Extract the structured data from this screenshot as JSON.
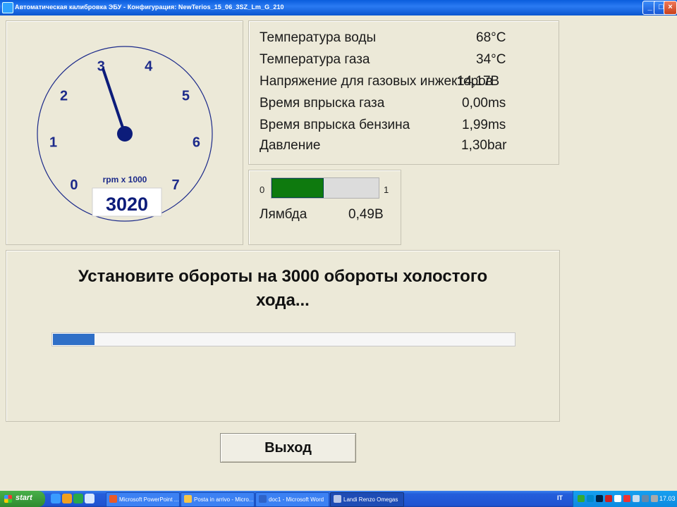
{
  "window": {
    "title": "Автоматическая калибровка ЭБУ - Конфигурация: NewTerios_15_06_3SZ_Lm_G_210",
    "minimize_label": "_",
    "maximize_label": "□",
    "close_label": "×"
  },
  "gauge": {
    "tick_labels": [
      "0",
      "1",
      "2",
      "3",
      "4",
      "5",
      "6",
      "7"
    ],
    "unit_label": "rpm x 1000",
    "rpm_value": "3020",
    "needle_value_thousands": 3.02,
    "max_value_thousands": 7
  },
  "info": {
    "rows": [
      {
        "label": "Температура воды",
        "value": "68°C"
      },
      {
        "label": "Температура газа",
        "value": "34°C"
      },
      {
        "label": "Напряжение для газовых инжекторов",
        "value": "14,17В"
      },
      {
        "label": "Время впрыска газа",
        "value": "0,00ms"
      },
      {
        "label": "Время впрыска бензина",
        "value": "1,99ms"
      },
      {
        "label": "Давление",
        "value": "1,30bar"
      }
    ]
  },
  "lambda": {
    "min_label": "0",
    "max_label": "1",
    "bar_fraction": 0.49,
    "label": "Лямбда",
    "value": "0,49В",
    "bar_color": "#0e7a0e"
  },
  "message": {
    "line1": "Установите обороты на 3000 обороты холостого",
    "line2": "хода...",
    "progress_fraction": 0.09,
    "progress_color": "#2f6fc7"
  },
  "exit_button": {
    "label": "Выход"
  },
  "taskbar": {
    "start_label": "start",
    "items": [
      {
        "label": "Microsoft PowerPoint ...",
        "active": false
      },
      {
        "label": "Posta in arrivo - Micro...",
        "active": false
      },
      {
        "label": "doc1 - Microsoft Word",
        "active": false
      },
      {
        "label": "Landi Renzo Omegas",
        "active": true
      }
    ],
    "language": "IT",
    "clock": "17.03"
  }
}
